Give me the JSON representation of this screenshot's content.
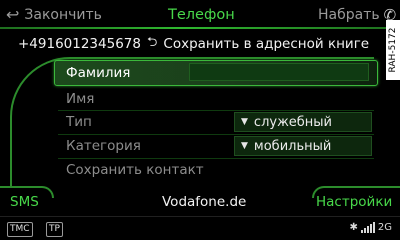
{
  "header": {
    "back_label": "Закончить",
    "title": "Телефон",
    "dial_label": "Набрать"
  },
  "number_line": {
    "number": "+4916012345678",
    "action": "Сохранить в адресной книге"
  },
  "side_tag": "RAH-5172",
  "form": {
    "rows": [
      {
        "label": "Фамилия",
        "value": ""
      },
      {
        "label": "Имя"
      },
      {
        "label": "Тип",
        "dropdown": "служебный"
      },
      {
        "label": "Категория",
        "dropdown": "мобильный"
      },
      {
        "label": "Сохранить контакт"
      }
    ]
  },
  "footer": {
    "left": "SMS",
    "center": "Vodafone.de",
    "right": "Настройки"
  },
  "status": {
    "tmc": "TMC",
    "tp": "TP",
    "network": "2G"
  },
  "colors": {
    "accent_green": "#48d84a",
    "frame_green": "#2c8c2c",
    "background": "#000000"
  }
}
